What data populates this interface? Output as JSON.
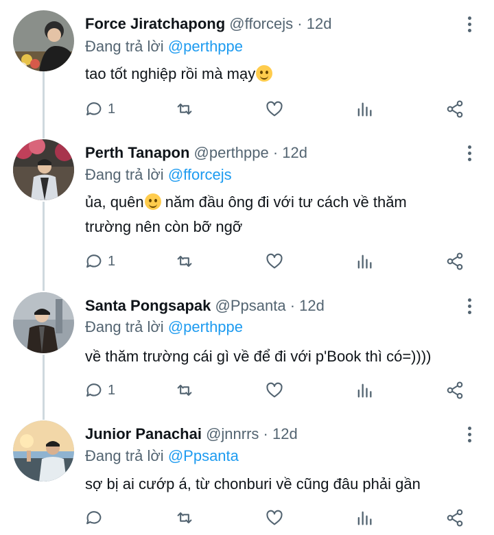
{
  "tweets": [
    {
      "name": "Force Jiratchapong",
      "handle": "@fforcejs",
      "dot": "·",
      "time": "12d",
      "replying_prefix": "Đang trả lời",
      "replying_to": "@perthppe",
      "text_before": "tao tốt nghiệp rồi mà mạy",
      "text_after": "",
      "emoji": "grinning-face",
      "reply_count": "1"
    },
    {
      "name": "Perth Tanapon",
      "handle": "@perthppe",
      "dot": "·",
      "time": "12d",
      "replying_prefix": "Đang trả lời",
      "replying_to": "@fforcejs",
      "text_before": "ủa, quên",
      "text_after": " năm đầu ông đi với tư cách về thăm trường nên còn bỡ ngỡ",
      "emoji": "smiling-face",
      "reply_count": "1"
    },
    {
      "name": "Santa Pongsapak",
      "handle": "@Ppsanta",
      "dot": "·",
      "time": "12d",
      "replying_prefix": "Đang trả lời",
      "replying_to": "@perthppe",
      "text_before": "về thăm trường cái gì về để đi với p'Book thì có=))))",
      "text_after": "",
      "emoji": "",
      "reply_count": "1"
    },
    {
      "name": "Junior Panachai",
      "handle": "@jnnrrs",
      "dot": "·",
      "time": "12d",
      "replying_prefix": "Đang trả lời",
      "replying_to": "@Ppsanta",
      "text_before": "sợ bị ai cướp á, từ chonburi về cũng đâu phải gần",
      "text_after": "",
      "emoji": "",
      "reply_count": ""
    }
  ],
  "icons": [
    "reply-icon",
    "retweet-icon",
    "like-icon",
    "analytics-icon",
    "share-icon",
    "more-icon"
  ],
  "colors": {
    "text": "#0f1419",
    "secondary": "#536471",
    "link": "#1d9bf0",
    "thread_line": "#cfd9de"
  }
}
